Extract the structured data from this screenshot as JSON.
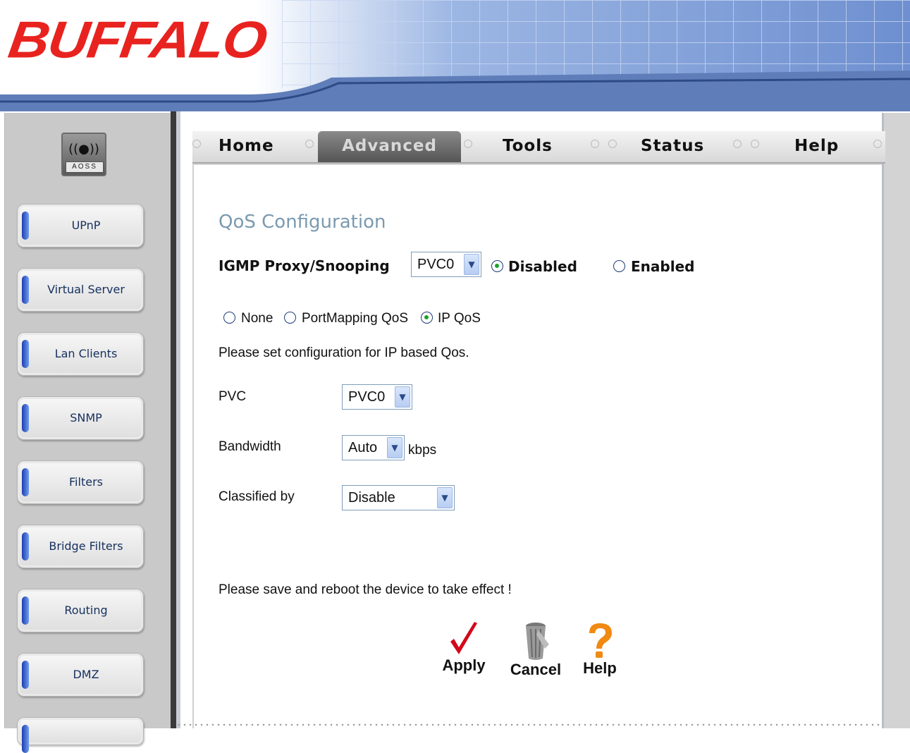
{
  "brand": {
    "logo_text": "BUFFALO",
    "logo_color": "#e8231f",
    "header_blue": "#8aa6d8"
  },
  "aoss": {
    "label": "AOSS"
  },
  "sidebar": {
    "items": [
      {
        "label": "UPnP"
      },
      {
        "label": "Virtual Server"
      },
      {
        "label": "Lan Clients"
      },
      {
        "label": "SNMP"
      },
      {
        "label": "Filters"
      },
      {
        "label": "Bridge Filters"
      },
      {
        "label": "Routing"
      },
      {
        "label": "DMZ"
      }
    ]
  },
  "tabs": [
    {
      "label": "Home",
      "active": false
    },
    {
      "label": "Advanced",
      "active": true
    },
    {
      "label": "Tools",
      "active": false
    },
    {
      "label": "Status",
      "active": false
    },
    {
      "label": "Help",
      "active": false
    }
  ],
  "page": {
    "title": "QoS Configuration",
    "igmp": {
      "label": "IGMP Proxy/Snooping",
      "pvc_value": "PVC0",
      "disabled_label": "Disabled",
      "enabled_label": "Enabled",
      "selected": "Disabled"
    },
    "qos_mode": {
      "options": [
        "None",
        "PortMapping QoS",
        "IP QoS"
      ],
      "selected": "IP QoS"
    },
    "instruction": "Please set configuration for IP based Qos.",
    "fields": {
      "pvc_label": "PVC",
      "pvc_value": "PVC0",
      "bandwidth_label": "Bandwidth",
      "bandwidth_value": "Auto",
      "bandwidth_unit": "kbps",
      "classified_label": "Classified by",
      "classified_value": "Disable"
    },
    "reboot_notice": "Please save and reboot the device to take effect !",
    "actions": {
      "apply": "Apply",
      "cancel": "Cancel",
      "help": "Help"
    }
  },
  "icons": {
    "apply": "check-icon",
    "cancel": "trash-icon",
    "help": "question-icon"
  }
}
